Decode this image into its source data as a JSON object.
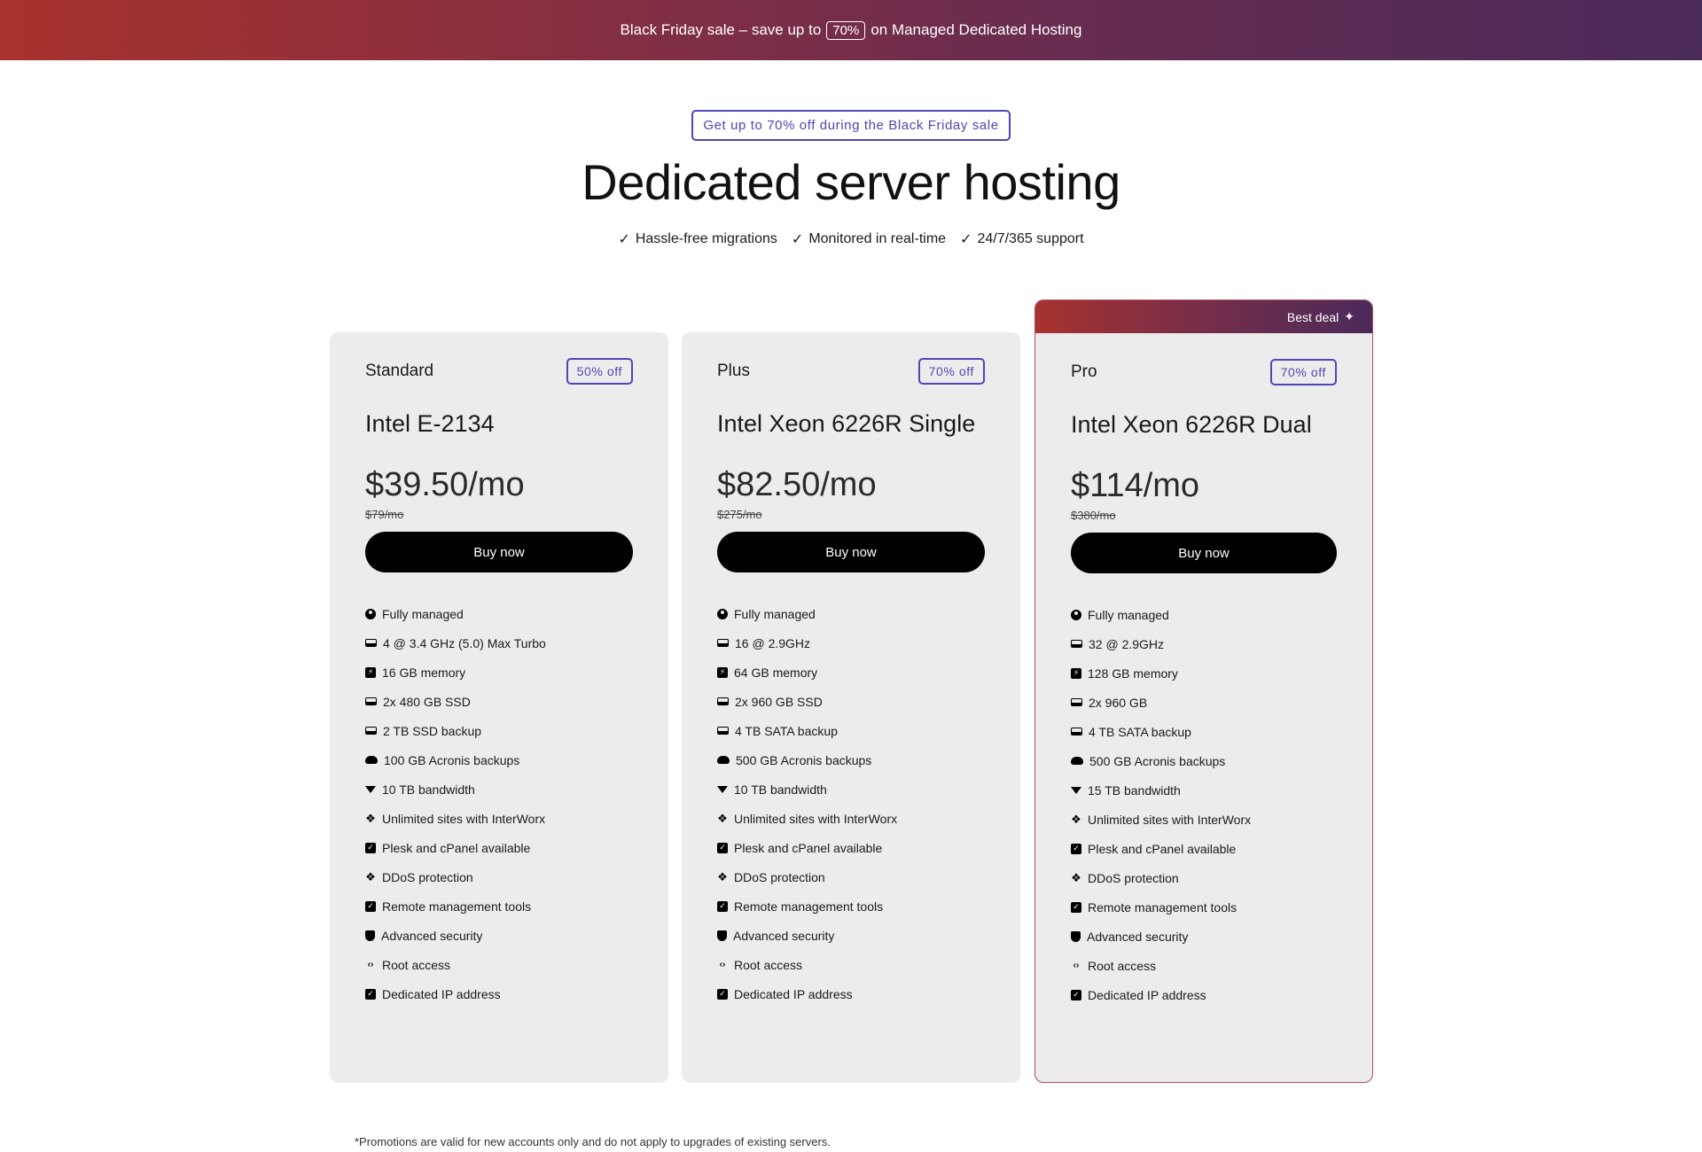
{
  "promo": {
    "text_before": "Black Friday sale – save up to",
    "percent": "70%",
    "text_after": "on Managed Dedicated Hosting"
  },
  "hero": {
    "chip": "Get up to 70% off during the Black Friday sale",
    "title": "Dedicated server hosting",
    "features": [
      "Hassle-free migrations",
      "Monitored in real-time",
      "24/7/365 support"
    ]
  },
  "plans": [
    {
      "tier": "Standard",
      "discount": "50% off",
      "cpu": "Intel E-2134",
      "price": "$39.50/mo",
      "old_price": "$79/mo",
      "buy_label": "Buy now",
      "specs": [
        {
          "icon": "user-icon",
          "text": "Fully managed"
        },
        {
          "icon": "drive-icon",
          "text": "4 @ 3.4 GHz (5.0) Max Turbo"
        },
        {
          "icon": "bolt-icon",
          "text": "16 GB memory"
        },
        {
          "icon": "storage-icon",
          "text": "2x 480 GB SSD"
        },
        {
          "icon": "storage-icon",
          "text": "2 TB SSD backup"
        },
        {
          "icon": "cloud-icon",
          "text": "100 GB Acronis backups"
        },
        {
          "icon": "gem-icon",
          "text": "10 TB bandwidth"
        },
        {
          "icon": "grid-icon",
          "text": "Unlimited sites with InterWorx"
        },
        {
          "icon": "checkbox-icon",
          "text": "Plesk and cPanel available"
        },
        {
          "icon": "grid-icon",
          "text": "DDoS protection"
        },
        {
          "icon": "checkbox-icon",
          "text": "Remote management tools"
        },
        {
          "icon": "shield-icon",
          "text": "Advanced security"
        },
        {
          "icon": "code-icon",
          "text": "Root access"
        },
        {
          "icon": "checkbox-icon",
          "text": "Dedicated IP address"
        }
      ]
    },
    {
      "tier": "Plus",
      "discount": "70% off",
      "cpu": "Intel Xeon 6226R Single",
      "price": "$82.50/mo",
      "old_price": "$275/mo",
      "buy_label": "Buy now",
      "specs": [
        {
          "icon": "user-icon",
          "text": "Fully managed"
        },
        {
          "icon": "drive-icon",
          "text": "16 @ 2.9GHz"
        },
        {
          "icon": "bolt-icon",
          "text": "64 GB memory"
        },
        {
          "icon": "storage-icon",
          "text": "2x 960 GB SSD"
        },
        {
          "icon": "storage-icon",
          "text": "4 TB SATA backup"
        },
        {
          "icon": "cloud-icon",
          "text": "500 GB Acronis backups"
        },
        {
          "icon": "gem-icon",
          "text": "10 TB bandwidth"
        },
        {
          "icon": "grid-icon",
          "text": "Unlimited sites with InterWorx"
        },
        {
          "icon": "checkbox-icon",
          "text": "Plesk and cPanel available"
        },
        {
          "icon": "grid-icon",
          "text": "DDoS protection"
        },
        {
          "icon": "checkbox-icon",
          "text": "Remote management tools"
        },
        {
          "icon": "shield-icon",
          "text": "Advanced security"
        },
        {
          "icon": "code-icon",
          "text": "Root access"
        },
        {
          "icon": "checkbox-icon",
          "text": "Dedicated IP address"
        }
      ]
    },
    {
      "tier": "Pro",
      "badge": "Best deal",
      "discount": "70% off",
      "cpu": "Intel Xeon 6226R Dual",
      "price": "$114/mo",
      "old_price": "$380/mo",
      "buy_label": "Buy now",
      "specs": [
        {
          "icon": "user-icon",
          "text": "Fully managed"
        },
        {
          "icon": "drive-icon",
          "text": "32 @ 2.9GHz"
        },
        {
          "icon": "bolt-icon",
          "text": "128 GB memory"
        },
        {
          "icon": "storage-icon",
          "text": "2x 960 GB"
        },
        {
          "icon": "storage-icon",
          "text": "4 TB SATA backup"
        },
        {
          "icon": "cloud-icon",
          "text": "500 GB Acronis backups"
        },
        {
          "icon": "gem-icon",
          "text": "15 TB bandwidth"
        },
        {
          "icon": "grid-icon",
          "text": "Unlimited sites with InterWorx"
        },
        {
          "icon": "checkbox-icon",
          "text": "Plesk and cPanel available"
        },
        {
          "icon": "grid-icon",
          "text": "DDoS protection"
        },
        {
          "icon": "checkbox-icon",
          "text": "Remote management tools"
        },
        {
          "icon": "shield-icon",
          "text": "Advanced security"
        },
        {
          "icon": "code-icon",
          "text": "Root access"
        },
        {
          "icon": "checkbox-icon",
          "text": "Dedicated IP address"
        }
      ]
    }
  ],
  "footnote": "*Promotions are valid for new accounts only and do not apply to upgrades of existing servers.",
  "colors": {
    "accent": "#4f46b8",
    "gradient_start": "#a8322d",
    "gradient_end": "#4a2a5a",
    "card_bg": "#ececec",
    "button_bg": "#000000"
  }
}
